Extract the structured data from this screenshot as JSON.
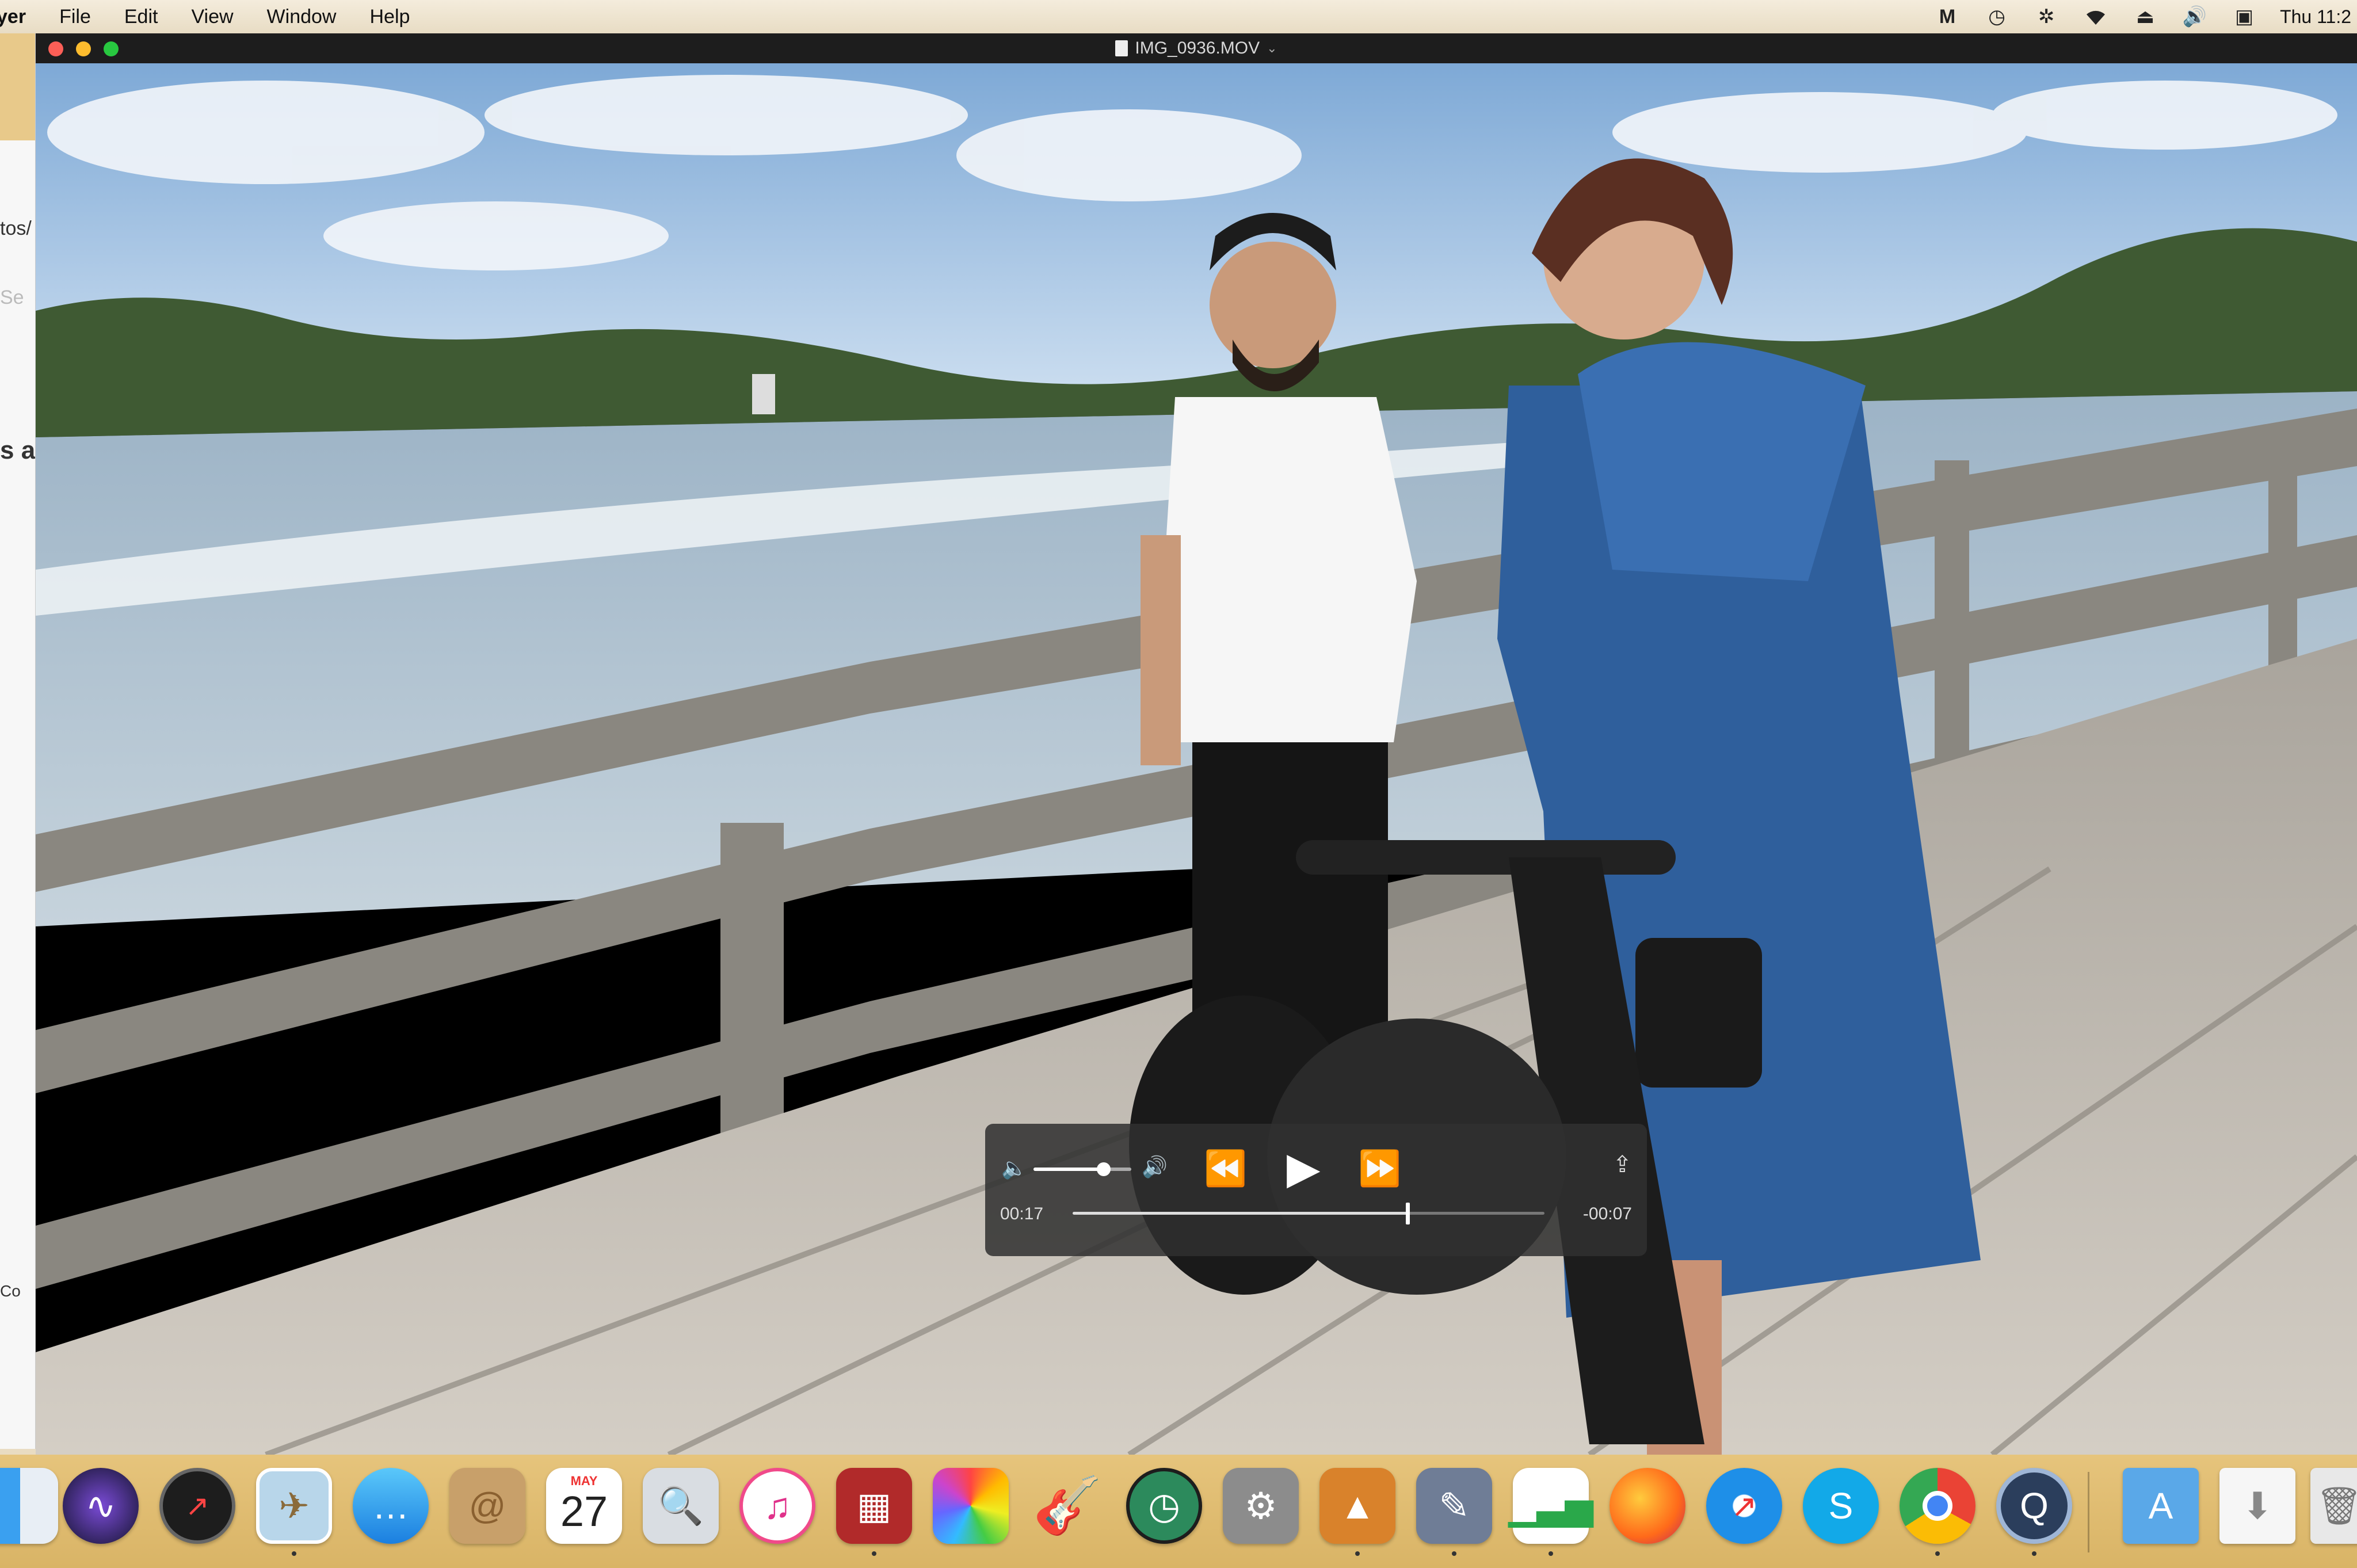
{
  "menubar": {
    "app_name": "yer",
    "menus": [
      "File",
      "Edit",
      "View",
      "Window",
      "Help"
    ],
    "status_icons": [
      "malwarebytes-icon",
      "time-machine-icon",
      "bluetooth-icon",
      "wifi-icon",
      "eject-icon",
      "volume-icon",
      "display-icon"
    ],
    "clock": "Thu 11:2"
  },
  "background_window": {
    "fragments": [
      "tos/",
      "Se",
      "s a",
      "Co"
    ]
  },
  "player": {
    "title": "IMG_0936.MOV",
    "elapsed": "00:17",
    "remaining": "-00:07",
    "progress": 0.71,
    "volume": 0.72
  },
  "dock": {
    "calendar": {
      "month": "MAY",
      "day": "27"
    },
    "items": [
      "finder-icon",
      "siri-icon",
      "dashboard-icon",
      "preview-icon",
      "messages-icon",
      "contacts-icon",
      "calendar-icon",
      "image-capture-icon",
      "itunes-icon",
      "photo-booth-icon",
      "photos-icon",
      "garageband-icon",
      "time-machine-icon",
      "system-preferences-icon",
      "keynote-icon",
      "script-editor-icon",
      "numbers-icon",
      "firefox-icon",
      "safari-icon",
      "skype-icon",
      "chrome-icon",
      "quicktime-icon",
      "applications-folder-icon",
      "downloads-icon",
      "trash-icon"
    ]
  }
}
